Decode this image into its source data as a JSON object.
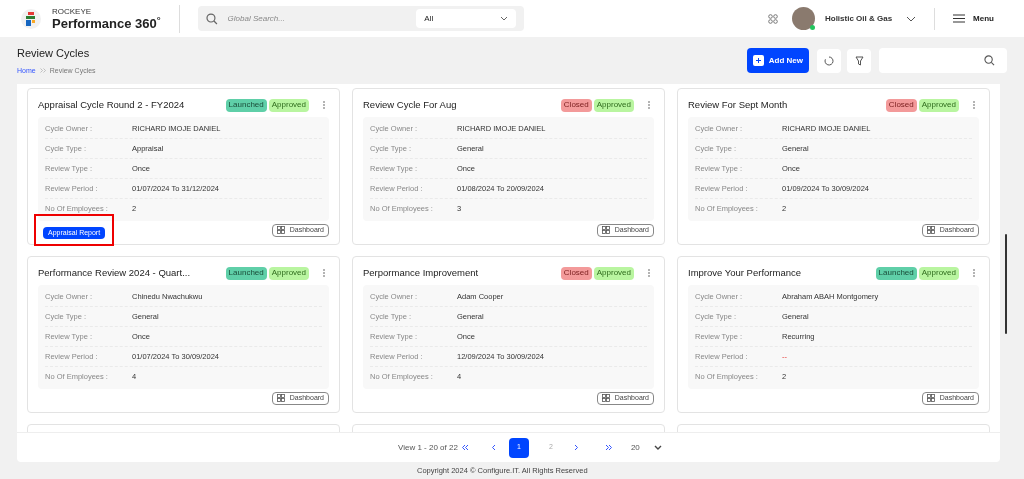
{
  "header": {
    "brand_top": "ROCKEYE",
    "brand_name": "Performance 360$^{°}$",
    "search": {
      "placeholder": "Global Search..."
    },
    "scope_select": {
      "value": "All"
    },
    "company": "Holistic Oil & Gas",
    "menu_label": "Menu"
  },
  "page": {
    "title": "Review Cycles",
    "breadcrumb": [
      {
        "label": "Home",
        "kind": "link"
      },
      {
        "label": "Review Cycles",
        "kind": "current"
      }
    ],
    "add_button": "Add New"
  },
  "cards": [
    {
      "title": "Appraisal Cycle Round 2 - FY2024",
      "badges": [
        {
          "label": "Launched",
          "kind": "launched"
        },
        {
          "label": "Approved",
          "kind": "approved"
        }
      ],
      "fields": [
        {
          "label": "Cycle Owner :",
          "value": "RICHARD IMOJE DANIEL",
          "kind": "text"
        },
        {
          "label": "Cycle Type :",
          "value": "Appraisal",
          "kind": "text"
        },
        {
          "label": "Review Type :",
          "value": "Once",
          "kind": "text"
        },
        {
          "label": "Review Period :",
          "value": "01/07/2024 To 31/12/2024",
          "kind": "text"
        },
        {
          "label": "No Of Employees :",
          "value": "2",
          "kind": "text"
        }
      ],
      "report_button": {
        "label": "Appraisal Report",
        "highlighted": true
      },
      "dashboard_button": "Dashboard"
    },
    {
      "title": "Review Cycle For Aug",
      "badges": [
        {
          "label": "Closed",
          "kind": "closed"
        },
        {
          "label": "Approved",
          "kind": "approved"
        }
      ],
      "fields": [
        {
          "label": "Cycle Owner :",
          "value": "RICHARD IMOJE DANIEL",
          "kind": "text"
        },
        {
          "label": "Cycle Type :",
          "value": "General",
          "kind": "text"
        },
        {
          "label": "Review Type :",
          "value": "Once",
          "kind": "text"
        },
        {
          "label": "Review Period :",
          "value": "01/08/2024 To 20/09/2024",
          "kind": "text"
        },
        {
          "label": "No Of Employees :",
          "value": "3",
          "kind": "text"
        }
      ],
      "dashboard_button": "Dashboard"
    },
    {
      "title": "Review For Sept Month",
      "badges": [
        {
          "label": "Closed",
          "kind": "closed"
        },
        {
          "label": "Approved",
          "kind": "approved"
        }
      ],
      "fields": [
        {
          "label": "Cycle Owner :",
          "value": "RICHARD IMOJE DANIEL",
          "kind": "text"
        },
        {
          "label": "Cycle Type :",
          "value": "General",
          "kind": "text"
        },
        {
          "label": "Review Type :",
          "value": "Once",
          "kind": "text"
        },
        {
          "label": "Review Period :",
          "value": "01/09/2024 To 30/09/2024",
          "kind": "text"
        },
        {
          "label": "No Of Employees :",
          "value": "2",
          "kind": "text"
        }
      ],
      "dashboard_button": "Dashboard"
    },
    {
      "title": "Performance Review 2024 - Quart...",
      "badges": [
        {
          "label": "Launched",
          "kind": "launched"
        },
        {
          "label": "Approved",
          "kind": "approved"
        }
      ],
      "fields": [
        {
          "label": "Cycle Owner :",
          "value": "Chinedu Nwachukwu",
          "kind": "text"
        },
        {
          "label": "Cycle Type :",
          "value": "General",
          "kind": "text"
        },
        {
          "label": "Review Type :",
          "value": "Once",
          "kind": "text"
        },
        {
          "label": "Review Period :",
          "value": "01/07/2024 To 30/09/2024",
          "kind": "text"
        },
        {
          "label": "No Of Employees :",
          "value": "4",
          "kind": "text"
        }
      ],
      "dashboard_button": "Dashboard"
    },
    {
      "title": "Perpormance Improvement",
      "badges": [
        {
          "label": "Closed",
          "kind": "closed"
        },
        {
          "label": "Approved",
          "kind": "approved"
        }
      ],
      "fields": [
        {
          "label": "Cycle Owner :",
          "value": "Adam Cooper",
          "kind": "text"
        },
        {
          "label": "Cycle Type :",
          "value": "General",
          "kind": "text"
        },
        {
          "label": "Review Type :",
          "value": "Once",
          "kind": "text"
        },
        {
          "label": "Review Period :",
          "value": "12/09/2024 To 30/09/2024",
          "kind": "text"
        },
        {
          "label": "No Of Employees :",
          "value": "4",
          "kind": "text"
        }
      ],
      "dashboard_button": "Dashboard"
    },
    {
      "title": "Improve Your Performance",
      "badges": [
        {
          "label": "Launched",
          "kind": "launched"
        },
        {
          "label": "Approved",
          "kind": "approved"
        }
      ],
      "fields": [
        {
          "label": "Cycle Owner :",
          "value": "Abraham ABAH Montgomery",
          "kind": "text"
        },
        {
          "label": "Cycle Type :",
          "value": "General",
          "kind": "text"
        },
        {
          "label": "Review Type :",
          "value": "Recurring",
          "kind": "text"
        },
        {
          "label": "Review Period :",
          "value": "--",
          "kind": "blank"
        },
        {
          "label": "No Of Employees :",
          "value": "2",
          "kind": "text"
        }
      ],
      "dashboard_button": "Dashboard"
    }
  ],
  "pagination": {
    "summary": "View 1 - 20 of 22",
    "pages": [
      {
        "label": "1",
        "selected": true
      },
      {
        "label": "2",
        "selected": false
      }
    ],
    "page_size": "20"
  },
  "footer": "Copyright 2024 © Configure.IT. All Rights Reserved"
}
